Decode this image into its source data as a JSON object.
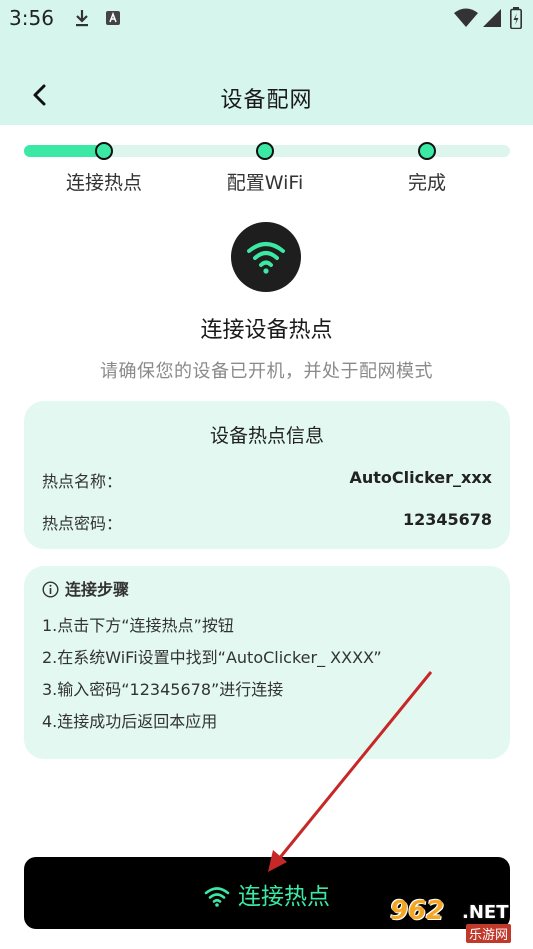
{
  "status_bar": {
    "time": "3:56"
  },
  "nav": {
    "title": "设备配网"
  },
  "progress": {
    "fraction": 0.16,
    "steps": [
      {
        "label": "连接热点"
      },
      {
        "label": "配置WiFi"
      },
      {
        "label": "完成"
      }
    ]
  },
  "hero": {
    "title": "连接设备热点",
    "subtitle": "请确保您的设备已开机，并处于配网模式"
  },
  "info_card": {
    "title": "设备热点信息",
    "rows": [
      {
        "key": "热点名称：",
        "value": "AutoClicker_xxx"
      },
      {
        "key": "热点密码：",
        "value": "12345678"
      }
    ]
  },
  "steps_card": {
    "title": "连接步骤",
    "items": [
      "1.点击下方“连接热点”按钮",
      "2.在系统WiFi设置中找到“AutoClicker_ XXXX”",
      "3.输入密码“12345678”进行连接",
      "4.连接成功后返回本应用"
    ]
  },
  "cta": {
    "label": "连接热点"
  },
  "watermark": {
    "num": "962",
    "net": ".NET",
    "sub": "乐游网"
  },
  "colors": {
    "accent": "#3be8a4",
    "header_bg": "#d6f5ec",
    "card_bg": "#e2f8f1",
    "annotation_arrow": "#d32f2f"
  }
}
